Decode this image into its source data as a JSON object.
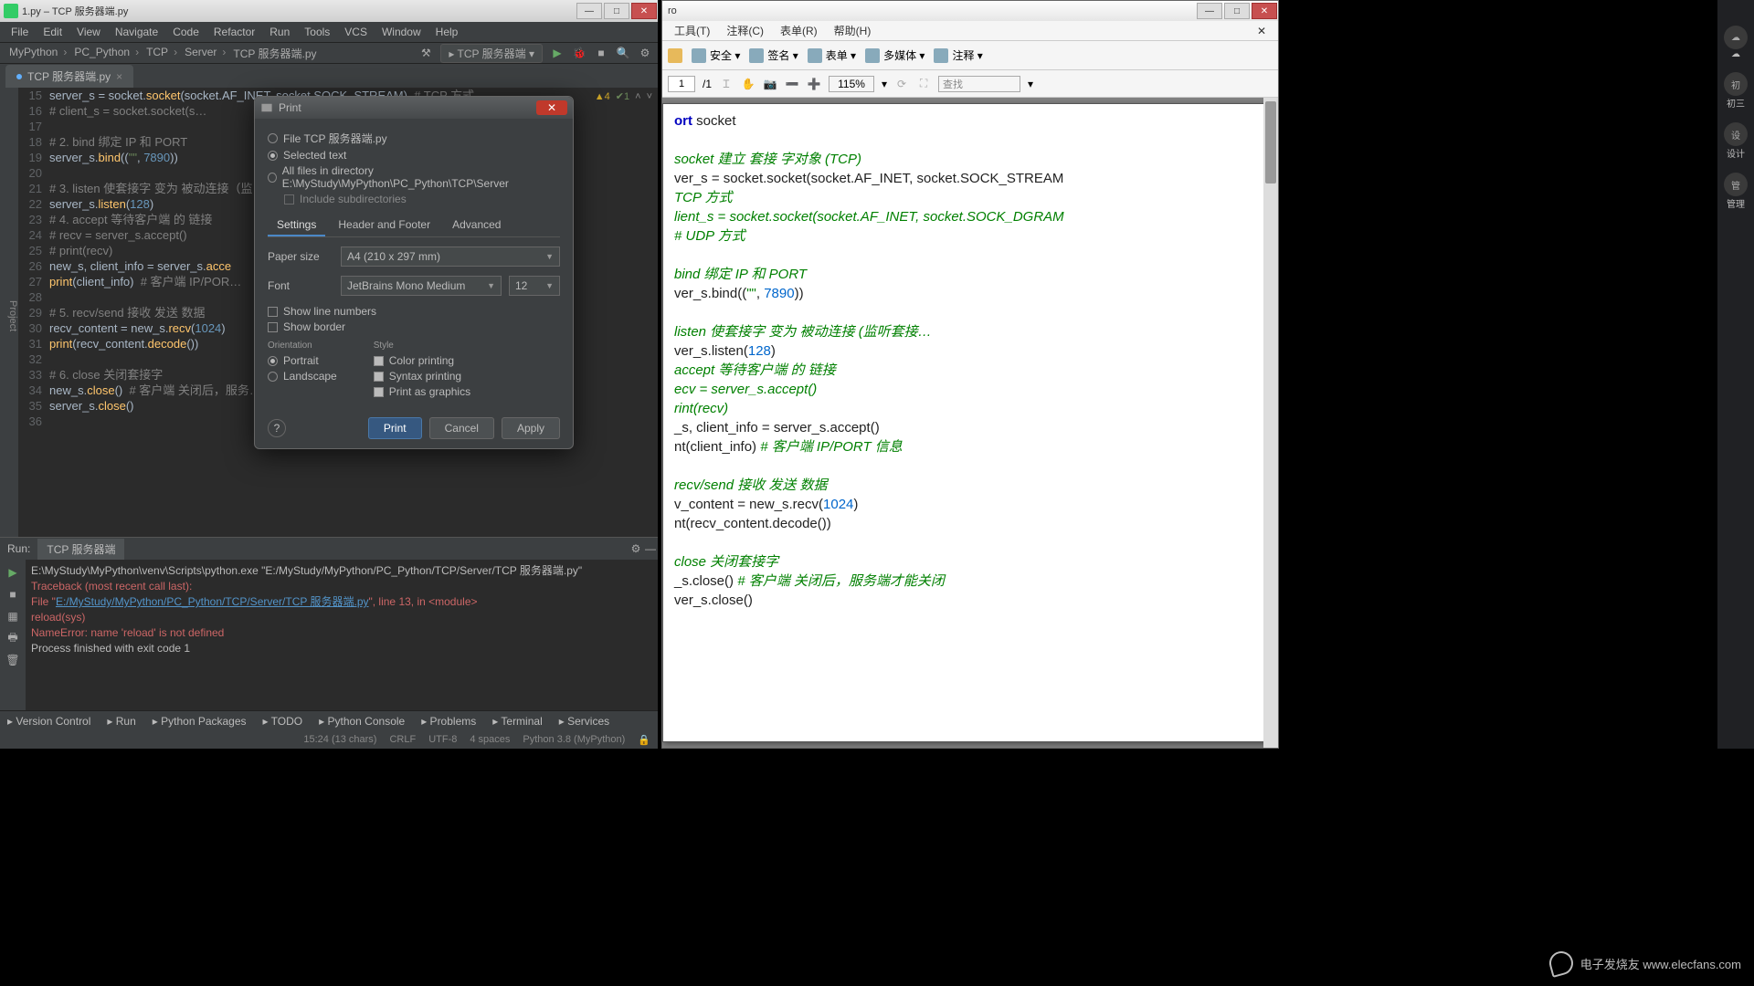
{
  "ide": {
    "title": "1.py – TCP 服务器端.py",
    "window_buttons": {
      "min": "—",
      "max": "□",
      "close": "✕"
    },
    "menus": [
      "File",
      "Edit",
      "View",
      "Navigate",
      "Code",
      "Refactor",
      "Run",
      "Tools",
      "VCS",
      "Window",
      "Help"
    ],
    "breadcrumbs": [
      "MyPython",
      "PC_Python",
      "TCP",
      "Server",
      "TCP 服务器端.py"
    ],
    "run_config": "TCP 服务器端",
    "tab": "TCP 服务器端.py",
    "flags": {
      "warn_label": "4",
      "ok_label": "1"
    },
    "code": [
      {
        "n": 15,
        "html": "server_s = socket.<span class='fn'>socket</span>(socket.AF_INET, socket.SOCK_STREAM)  <span class='cm'># TCP 方式</span>"
      },
      {
        "n": 16,
        "html": "<span class='cm'># client_s = socket.socket(s…</span>"
      },
      {
        "n": 17,
        "html": ""
      },
      {
        "n": 18,
        "html": "<span class='cm'># 2. bind 绑定 IP 和 PORT</span>"
      },
      {
        "n": 19,
        "html": "server_s.<span class='fn'>bind</span>((<span class='str'>\"\"</span>, <span class='num'>7890</span>))"
      },
      {
        "n": 20,
        "html": ""
      },
      {
        "n": 21,
        "html": "<span class='cm'># 3. listen 使套接字 变为 被动连接（监…</span>"
      },
      {
        "n": 22,
        "html": "server_s.<span class='fn'>listen</span>(<span class='num'>128</span>)"
      },
      {
        "n": 23,
        "html": "<span class='cm'># 4. accept 等待客户端 的 链接</span>"
      },
      {
        "n": 24,
        "html": "<span class='cm'># recv = server_s.accept()</span>"
      },
      {
        "n": 25,
        "html": "<span class='cm'># print(recv)</span>"
      },
      {
        "n": 26,
        "html": "new_s, client_info = server_s.<span class='fn'>acce</span>"
      },
      {
        "n": 27,
        "html": "<span class='fn'>print</span>(client_info)  <span class='cm'># 客户端 IP/POR…</span>"
      },
      {
        "n": 28,
        "html": ""
      },
      {
        "n": 29,
        "html": "<span class='cm'># 5. recv/send 接收 发送 数据</span>"
      },
      {
        "n": 30,
        "html": "recv_content = new_s.<span class='fn'>recv</span>(<span class='num'>1024</span>)"
      },
      {
        "n": 31,
        "html": "<span class='fn'>print</span>(recv_content.<span class='fn'>decode</span>())"
      },
      {
        "n": 32,
        "html": ""
      },
      {
        "n": 33,
        "html": "<span class='cm'># 6. close 关闭套接字</span>"
      },
      {
        "n": 34,
        "html": "new_s.<span class='fn'>close</span>()  <span class='cm'># 客户端 关闭后，服务…</span>"
      },
      {
        "n": 35,
        "html": "server_s.<span class='fn'>close</span>()"
      },
      {
        "n": 36,
        "html": ""
      }
    ],
    "run": {
      "label": "Run:",
      "tab": "TCP 服务器端",
      "output": [
        "E:\\MyStudy\\MyPython\\venv\\Scripts\\python.exe \"E:/MyStudy/MyPython/PC_Python/TCP/Server/TCP 服务器端.py\"",
        "<span class='err'>Traceback (most recent call last):</span>",
        "<span class='err'>  File \"<span class='lnk'>E:/MyStudy/MyPython/PC_Python/TCP/Server/TCP 服务器端.py</span>\", line 13, in &lt;module&gt;</span>",
        "<span class='err'>    reload(sys)</span>",
        "<span class='err'>NameError: name 'reload' is not defined</span>",
        "",
        "Process finished with exit code 1"
      ]
    },
    "toolstrip": [
      "Version Control",
      "Run",
      "Python Packages",
      "TODO",
      "Python Console",
      "Problems",
      "Terminal",
      "Services"
    ],
    "status": {
      "pos": "15:24 (13 chars)",
      "eol": "CRLF",
      "enc": "UTF-8",
      "indent": "4 spaces",
      "interp": "Python 3.8 (MyPython)"
    }
  },
  "dialog": {
    "title": "Print",
    "scope": {
      "file": "File TCP 服务器端.py",
      "selected": "Selected text",
      "alldir": "All files in directory E:\\MyStudy\\MyPython\\PC_Python\\TCP\\Server",
      "include_sub": "Include subdirectories"
    },
    "tabs": [
      "Settings",
      "Header and Footer",
      "Advanced"
    ],
    "paper_label": "Paper size",
    "paper_value": "A4   (210 x 297 mm)",
    "font_label": "Font",
    "font_value": "JetBrains Mono Medium",
    "font_size": "12",
    "show_ln": "Show line numbers",
    "show_border": "Show border",
    "orientation_label": "Orientation",
    "portrait": "Portrait",
    "landscape": "Landscape",
    "style_label": "Style",
    "color": "Color printing",
    "syntax": "Syntax printing",
    "graphics": "Print as graphics",
    "btn_print": "Print",
    "btn_cancel": "Cancel",
    "btn_apply": "Apply"
  },
  "pdf": {
    "title": "ro",
    "menus": [
      "工具(T)",
      "注释(C)",
      "表单(R)",
      "帮助(H)"
    ],
    "toolbar": [
      {
        "id": "safe",
        "label": "安全 ▾"
      },
      {
        "id": "sign",
        "label": "签名 ▾"
      },
      {
        "id": "form",
        "label": "表单 ▾"
      },
      {
        "id": "media",
        "label": "多媒体 ▾"
      },
      {
        "id": "note",
        "label": "注释 ▾"
      }
    ],
    "page_cur": "1",
    "page_tot": "/1",
    "zoom": "115%",
    "search_placeholder": "查找",
    "lines": [
      "<span class='pkw'>ort</span> socket",
      "",
      " <span class='pcm'>socket 建立 套接 字对象 (TCP)</span>",
      "ver_s = socket.socket(socket.AF_INET, socket.SOCK_STREAM",
      "<span class='pcm'> TCP 方式</span>",
      "<span class='pcm'>lient_s = socket.socket(socket.AF_INET, socket.SOCK_DGRAM</span>",
      " <span class='pcm'># UDP 方式</span>",
      "",
      " <span class='pcm'>bind 绑定 IP 和 PORT</span>",
      "ver_s.bind((<span class='pstr'>\"\"</span>, <span class='pnum'>7890</span>))",
      "",
      " <span class='pcm'>listen 使套接字 变为 被动连接 (监听套接…</span>",
      "ver_s.listen(<span class='pnum'>128</span>)",
      " <span class='pcm'>accept 等待客户端 的 链接</span>",
      "<span class='pcm'>ecv = server_s.accept()</span>",
      "<span class='pcm'>rint(recv)</span>",
      "_s, client_info = server_s.accept()",
      "nt(client_info)  <span class='pcm'># 客户端 IP/PORT 信息</span>",
      "",
      " <span class='pcm'>recv/send 接收 发送 数据</span>",
      "v_content = new_s.recv(<span class='pnum'>1024</span>)",
      "nt(recv_content.decode())",
      "",
      " <span class='pcm'>close 关闭套接字</span>",
      "_s.close()  <span class='pcm'># 客户端 关闭后，服务端才能关闭</span>",
      "ver_s.close()"
    ]
  },
  "sidebar_items": [
    {
      "id": "weather",
      "label": "☁"
    },
    {
      "id": "chusan",
      "label": "初三"
    },
    {
      "id": "design",
      "label": "设计"
    },
    {
      "id": "manage",
      "label": "管理"
    }
  ],
  "watermark": "电子发烧友  www.elecfans.com"
}
